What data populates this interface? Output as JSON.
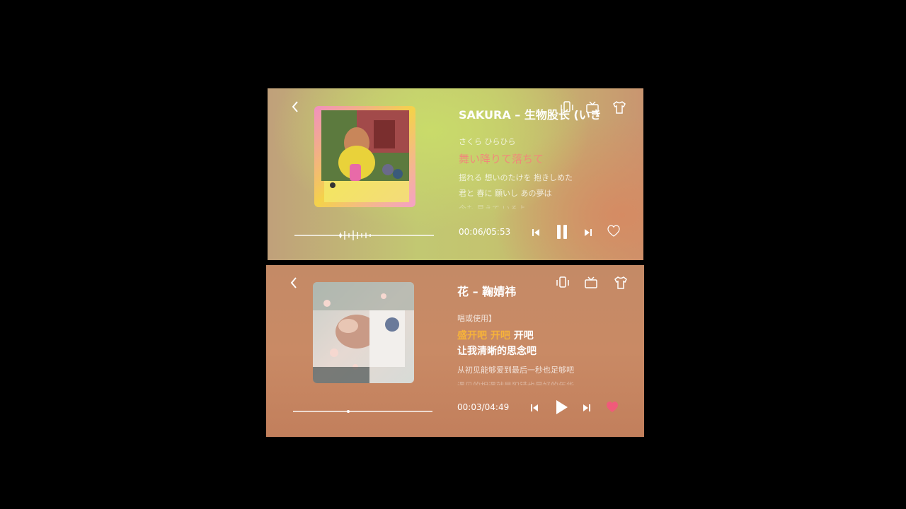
{
  "players": {
    "top": {
      "title": "SAKURA – 生物股长 (いき",
      "lyrics": [
        "さくら ひらひら",
        "舞い降りて落ちて",
        "揺れる 想いのたけを 抱きしめた",
        "君と 春に 願いし あの夢は",
        "今も 見えて いるよ"
      ],
      "time": "00:06/05:53",
      "progress": 0.33,
      "state": "playing",
      "liked": false
    },
    "bottom": {
      "title": "花 – 鞠婧祎",
      "lyrics_top": "唱或使用】",
      "lyric_active_sung": "盛开吧 开吧",
      "lyric_active_rest": " 开吧",
      "lyric_next": "让我清晰的思念吧",
      "lyric_after": "从初见能够爱到最后一秒也足够吧",
      "lyric_fade": "遇见的相遇就是犯错也最好的年华",
      "time": "00:03/04:49",
      "progress": 0.39,
      "state": "paused",
      "liked": true
    }
  },
  "colors": {
    "lyric_active_top": "#f08a7a",
    "lyric_active_bottom": "#f6b23a",
    "heart": "#f05a7a"
  }
}
